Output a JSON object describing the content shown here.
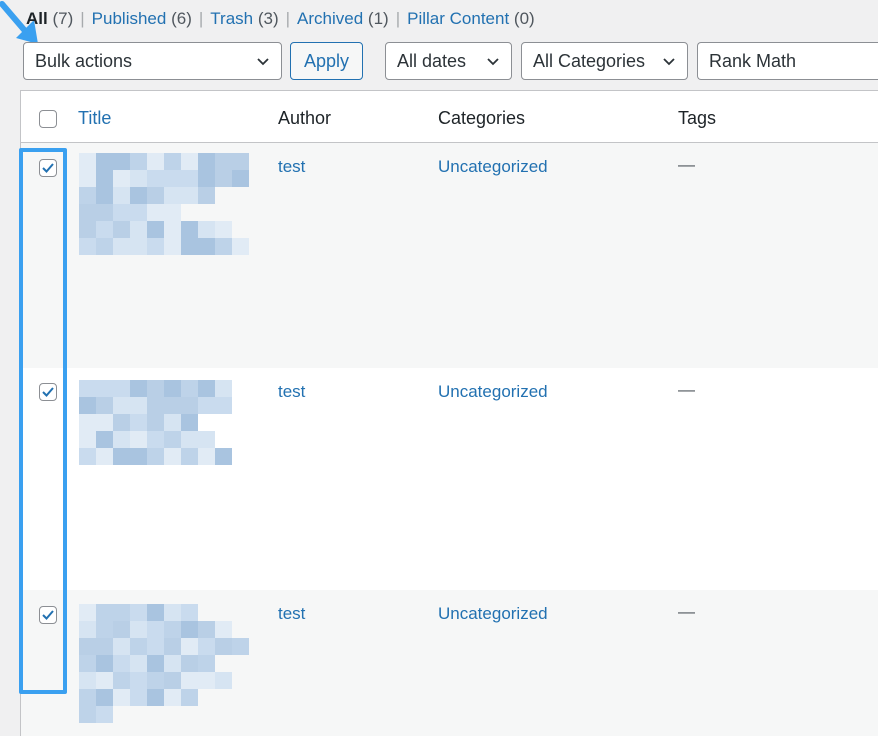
{
  "views": {
    "all_label": "All",
    "all_count": "(7)",
    "published_label": "Published",
    "published_count": "(6)",
    "trash_label": "Trash",
    "trash_count": "(3)",
    "archived_label": "Archived",
    "archived_count": "(1)",
    "pillar_label": "Pillar Content",
    "pillar_count": "(0)"
  },
  "filters": {
    "bulk_actions": "Bulk actions",
    "apply": "Apply",
    "dates": "All dates",
    "categories": "All Categories",
    "rank_math": "Rank Math"
  },
  "table": {
    "columns": {
      "title": "Title",
      "author": "Author",
      "categories": "Categories",
      "tags": "Tags"
    },
    "rows": [
      {
        "author": "test",
        "category": "Uncategorized",
        "tags": "—",
        "checked": true
      },
      {
        "author": "test",
        "category": "Uncategorized",
        "tags": "—",
        "checked": true
      },
      {
        "author": "test",
        "category": "Uncategorized",
        "tags": "—",
        "checked": true
      }
    ]
  },
  "colors": {
    "link": "#2271b1",
    "highlight": "#3aa0f0",
    "check": "#2271b1"
  },
  "icons": [
    "arrow-pointer-icon",
    "chevron-down-icon",
    "checkmark-icon"
  ]
}
